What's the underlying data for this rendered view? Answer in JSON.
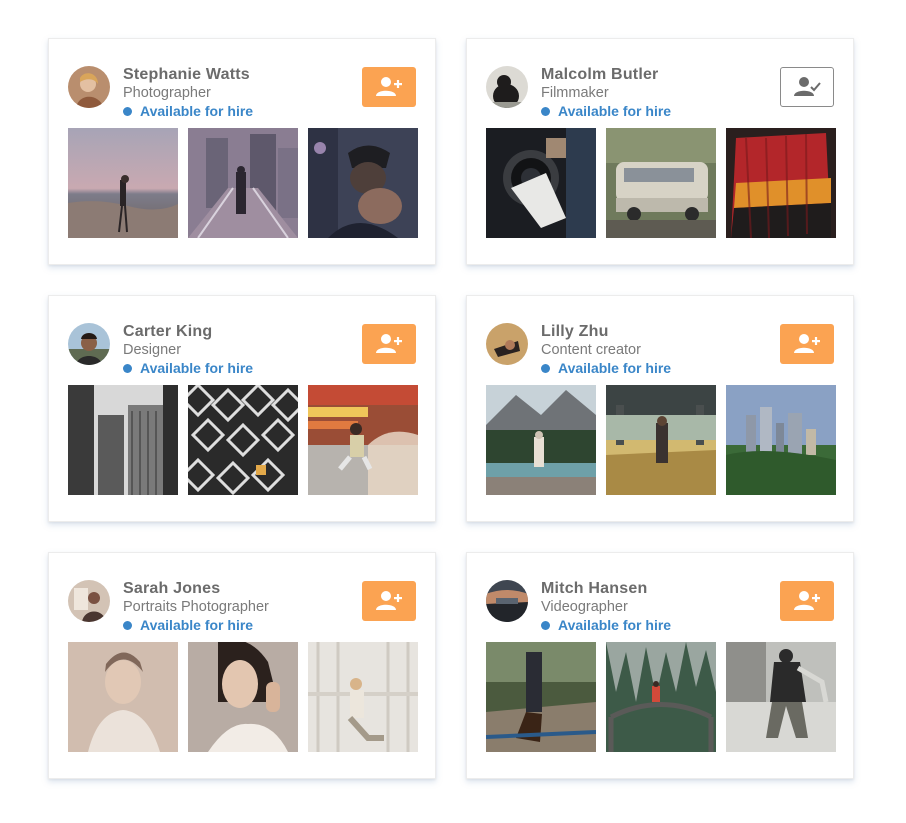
{
  "profiles": [
    {
      "name": "Stephanie Watts",
      "role": "Photographer",
      "status": "Available for hire",
      "follow_state": "add",
      "avatar": "avatar-photo"
    },
    {
      "name": "Malcolm Butler",
      "role": "Filmmaker",
      "status": "Available for hire",
      "follow_state": "following",
      "avatar": "avatar-photo"
    },
    {
      "name": "Carter King",
      "role": "Designer",
      "status": "Available for hire",
      "follow_state": "add",
      "avatar": "avatar-photo"
    },
    {
      "name": "Lilly Zhu",
      "role": "Content creator",
      "status": "Available for hire",
      "follow_state": "add",
      "avatar": "avatar-photo"
    },
    {
      "name": "Sarah Jones",
      "role": "Portraits Photographer",
      "status": "Available for hire",
      "follow_state": "add",
      "avatar": "avatar-photo"
    },
    {
      "name": "Mitch Hansen",
      "role": "Videographer",
      "status": "Available for hire",
      "follow_state": "add",
      "avatar": "avatar-photo"
    }
  ],
  "icons": {
    "add": "add-user-icon",
    "following": "user-check-icon"
  },
  "colors": {
    "accent": "#fba352",
    "status": "#3a86c8",
    "name": "#6b6b6b",
    "role": "#7a7a7a",
    "button_outline": "#8a8a8a"
  }
}
